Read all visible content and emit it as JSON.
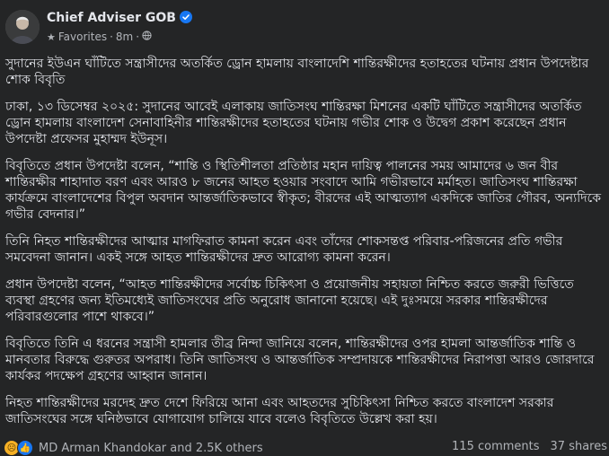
{
  "post": {
    "author": "Chief Adviser GOB",
    "audience": "Favorites",
    "time": "8m",
    "paragraphs": [
      "সুদানের ইউএন ঘাঁটিতে সন্ত্রাসীদের অতর্কিত ড্রোন হামলায় বাংলাদেশি শান্তিরক্ষীদের হতাহতের ঘটনায় প্রধান উপদেষ্টার শোক বিবৃতি",
      "ঢাকা, ১৩ ডিসেম্বর ২০২৫: সুদানের আবেই এলাকায় জাতিসংঘ শান্তিরক্ষা মিশনের একটি ঘাঁটিতে সন্ত্রাসীদের অতর্কিত ড্রোন হামলায় বাংলাদেশ সেনাবাহিনীর শান্তিরক্ষীদের হতাহতের ঘটনায় গভীর শোক ও উদ্বেগ প্রকাশ করেছেন প্রধান উপদেষ্টা প্রফেসর মুহাম্মদ ইউনূস।",
      "বিবৃতিতে প্রধান উপদেষ্টা বলেন, “শান্তি ও স্থিতিশীলতা প্রতিষ্ঠার মহান দায়িত্ব পালনের সময় আমাদের ৬ জন বীর শান্তিরক্ষীর শাহাদাত বরণ এবং আরও ৮ জনের আহত হওয়ার সংবাদে আমি গভীরভাবে মর্মাহত। জাতিসংঘ শান্তিরক্ষা কার্যক্রমে বাংলাদেশের বিপুল অবদান আন্তর্জাতিকভাবে স্বীকৃত; বীরদের এই আত্মত্যাগ একদিকে জাতির গৌরব, অন্যদিকে গভীর বেদনার।”",
      "তিনি নিহত শান্তিরক্ষীদের আত্মার মাগফিরাত কামনা করেন এবং তাঁদের শোকসন্তপ্ত পরিবার-পরিজনের প্রতি গভীর সমবেদনা জানান। একই সঙ্গে আহত শান্তিরক্ষীদের দ্রুত আরোগ্য কামনা করেন।",
      "প্রধান উপদেষ্টা বলেন, “আহত শান্তিরক্ষীদের সর্বোচ্চ চিকিৎসা ও প্রয়োজনীয় সহায়তা নিশ্চিত করতে জরুরী ভিত্তিতে ব্যবস্থা গ্রহণের জন্য ইতিমধ্যেই জাতিসংঘের প্রতি অনুরোধ জানানো হয়েছে। এই দুঃসময়ে সরকার শান্তিরক্ষীদের পরিবারগুলোর পাশে থাকবে।”",
      "বিবৃতিতে তিনি এ ধরনের সন্ত্রাসী হামলার তীব্র নিন্দা জানিয়ে বলেন, শান্তিরক্ষীদের ওপর হামলা আন্তর্জাতিক শান্তি ও মানবতার বিরুদ্ধে গুরুতর অপরাধ। তিনি জাতিসংঘ ও আন্তর্জাতিক সম্প্রদায়কে শান্তিরক্ষীদের নিরাপত্তা আরও জোরদারে কার্যকর পদক্ষেপ গ্রহণের আহ্বান জানান।",
      "নিহত শান্তিরক্ষীদের মরদেহ দ্রুত দেশে ফিরিয়ে আনা এবং আহতদের সুচিকিৎসা নিশ্চিত করতে বাংলাদেশ সরকার জাতিসংঘের সঙ্গে ঘনিষ্ঠভাবে যোগাযোগ চালিয়ে যাবে বলেও বিবৃতিতে উল্লেখ করা হয়।"
    ]
  },
  "footer": {
    "reactions_text": "MD Arman Khandokar and 2.5K others",
    "comments": "115 comments",
    "shares": "37 shares"
  },
  "icons": {
    "verified": "verified-badge-icon",
    "favorites": "star-icon",
    "audience": "globe-icon",
    "reaction_sad": "sad-reaction-icon",
    "reaction_like": "like-reaction-icon"
  },
  "colors": {
    "background": "#242526",
    "text": "#e4e6eb",
    "secondary": "#b0b3b8",
    "verified": "#1877f2"
  }
}
